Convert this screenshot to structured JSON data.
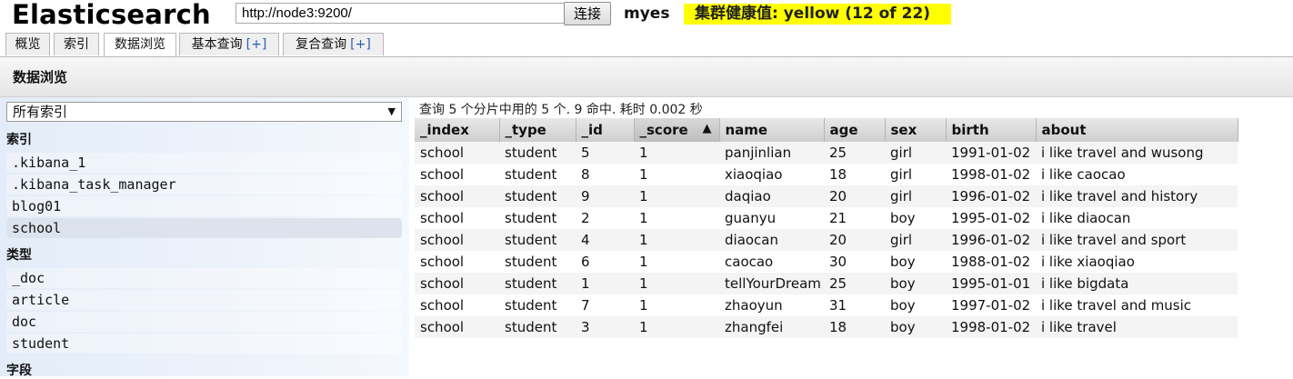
{
  "app": {
    "title": "Elasticsearch"
  },
  "connection": {
    "url": "http://node3:9200/",
    "connect_label": "连接"
  },
  "cluster": {
    "name": "myes",
    "health": "集群健康值: yellow (12 of 22)",
    "health_color": "#ffff00"
  },
  "tabs": [
    {
      "label": "概览",
      "plus": ""
    },
    {
      "label": "索引",
      "plus": ""
    },
    {
      "label": "数据浏览",
      "plus": "",
      "active": true
    },
    {
      "label": "基本查询",
      "plus": "[+]"
    },
    {
      "label": "复合查询",
      "plus": "[+]"
    }
  ],
  "section": {
    "title": "数据浏览"
  },
  "sidebar": {
    "index_select": "所有索引",
    "groups": [
      {
        "heading": "索引",
        "items": [
          ".kibana_1",
          ".kibana_task_manager",
          "blog01",
          "school"
        ],
        "selected": "school"
      },
      {
        "heading": "类型",
        "items": [
          "_doc",
          "article",
          "doc",
          "student"
        ]
      },
      {
        "heading": "字段",
        "items": []
      }
    ]
  },
  "results": {
    "summary": "查询 5 个分片中用的 5 个. 9 命中. 耗时 0.002 秒",
    "columns": [
      "_index",
      "_type",
      "_id",
      "_score",
      "name",
      "age",
      "sex",
      "birth",
      "about"
    ],
    "sorted_column": "_score",
    "sort_arrow": "▲",
    "rows": [
      [
        "school",
        "student",
        "5",
        "1",
        "panjinlian",
        "25",
        "girl",
        "1991-01-02",
        "i like travel and wusong"
      ],
      [
        "school",
        "student",
        "8",
        "1",
        "xiaoqiao",
        "18",
        "girl",
        "1998-01-02",
        "i like caocao"
      ],
      [
        "school",
        "student",
        "9",
        "1",
        "daqiao",
        "20",
        "girl",
        "1996-01-02",
        "i like travel and history"
      ],
      [
        "school",
        "student",
        "2",
        "1",
        "guanyu",
        "21",
        "boy",
        "1995-01-02",
        "i like diaocan"
      ],
      [
        "school",
        "student",
        "4",
        "1",
        "diaocan",
        "20",
        "girl",
        "1996-01-02",
        "i like travel and sport"
      ],
      [
        "school",
        "student",
        "6",
        "1",
        "caocao",
        "30",
        "boy",
        "1988-01-02",
        "i like xiaoqiao"
      ],
      [
        "school",
        "student",
        "1",
        "1",
        "tellYourDream",
        "25",
        "boy",
        "1995-01-01",
        "i like bigdata"
      ],
      [
        "school",
        "student",
        "7",
        "1",
        "zhaoyun",
        "31",
        "boy",
        "1997-01-02",
        "i like travel and music"
      ],
      [
        "school",
        "student",
        "3",
        "1",
        "zhangfei",
        "18",
        "boy",
        "1998-01-02",
        "i like travel"
      ]
    ]
  }
}
